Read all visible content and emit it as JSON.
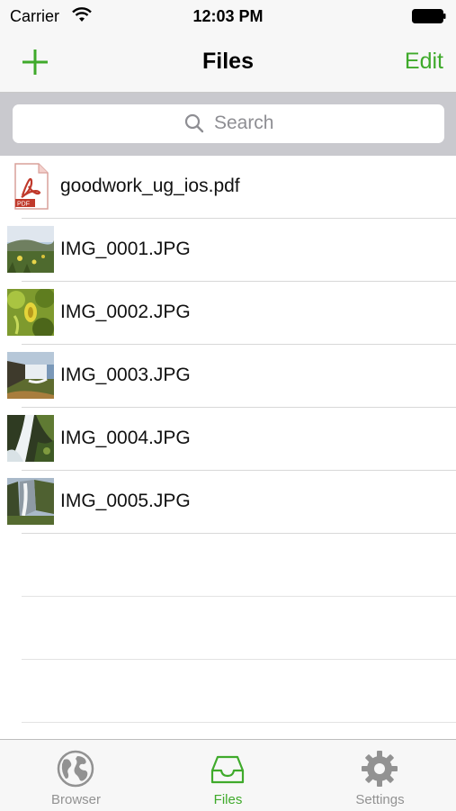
{
  "status_bar": {
    "carrier": "Carrier",
    "time": "12:03 PM"
  },
  "nav": {
    "title": "Files",
    "edit_label": "Edit",
    "add_icon": "plus-icon"
  },
  "search": {
    "placeholder": "Search"
  },
  "files": [
    {
      "name": "goodwork_ug_ios.pdf",
      "type": "pdf",
      "badge": "PDF"
    },
    {
      "name": "IMG_0001.JPG",
      "type": "image"
    },
    {
      "name": "IMG_0002.JPG",
      "type": "image"
    },
    {
      "name": "IMG_0003.JPG",
      "type": "image"
    },
    {
      "name": "IMG_0004.JPG",
      "type": "image"
    },
    {
      "name": "IMG_0005.JPG",
      "type": "image"
    }
  ],
  "tab_bar": {
    "tabs": [
      {
        "label": "Browser",
        "icon": "globe-icon",
        "active": false
      },
      {
        "label": "Files",
        "icon": "inbox-tray-icon",
        "active": true
      },
      {
        "label": "Settings",
        "icon": "gear-icon",
        "active": false
      }
    ]
  },
  "colors": {
    "accent": "#3faa2b",
    "nav_bg": "#f7f7f7",
    "search_bar_bg": "#c9c9ce",
    "inactive_tab": "#929292"
  }
}
